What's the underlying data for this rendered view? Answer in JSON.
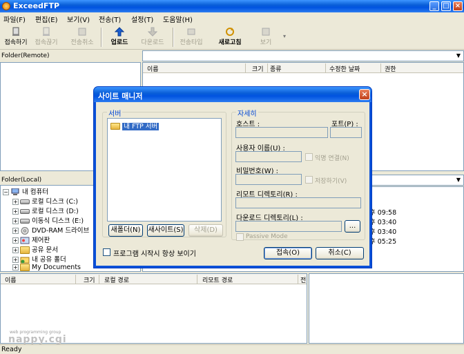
{
  "window": {
    "title": "ExceedFTP"
  },
  "menu": [
    "파일(F)",
    "편집(E)",
    "보기(V)",
    "전송(T)",
    "설정(T)",
    "도움말(H)"
  ],
  "toolbar": {
    "connect": "접속하기",
    "disconnect": "접속끊기",
    "cancel": "전송취소",
    "upload": "업로드",
    "download": "다운로드",
    "transfer_type": "전송타입",
    "refresh": "새로고침",
    "view": "보기"
  },
  "remote": {
    "label": "Folder(Remote)",
    "columns": [
      "이름",
      "크기",
      "종류",
      "수정한 날짜",
      "권한"
    ]
  },
  "local": {
    "label": "Folder(Local)",
    "tree": [
      "내 컴퓨터",
      "로컬 디스크 (C:)",
      "로컬 디스크 (D:)",
      "이동식 디스크 (E:)",
      "DVD-RAM 드라이브",
      "제어판",
      "공유 문서",
      "내 공유 폴더",
      "My Documents"
    ],
    "times": [
      "후 09:58",
      "후 03:40",
      "후 03:40",
      "후 05:25"
    ]
  },
  "queue": {
    "columns": [
      "이름",
      "크기",
      "로컬 경로",
      "리모트 경로",
      "전"
    ]
  },
  "dialog": {
    "title": "사이트 매니저",
    "server_group": "서버",
    "server_item": "내 FTP 서버",
    "new_folder": "새폴더(N)",
    "new_site": "새사이트(S)",
    "delete": "삭제(D)",
    "show_on_start": "프로그램 시작시 항상 보이기",
    "details_group": "자세히",
    "host": "호스트 :",
    "port": "포트(P) :",
    "username": "사용자 이름(U) :",
    "anonymous": "익명 연결(N)",
    "password": "비밀번호(W) :",
    "save": "저장하기(V)",
    "remote_dir": "리모트 디렉토리(R) :",
    "download_dir": "다운로드 디렉토리(L) :",
    "browse": "...",
    "passive": "Passive Mode",
    "connect": "접속(O)",
    "cancel": "취소(C)"
  },
  "watermark": {
    "sub": "web programming group",
    "brand": "nappy.cgi"
  },
  "status": {
    "text": "Ready"
  },
  "colors": {
    "title_blue": "#0a5fd8",
    "group_label": "#0046d5",
    "window_bg": "#ece9d8"
  }
}
